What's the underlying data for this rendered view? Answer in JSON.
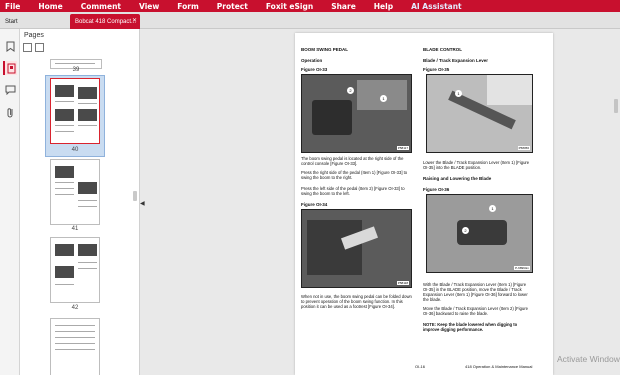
{
  "menubar": {
    "items": [
      "File",
      "Home",
      "Comment",
      "View",
      "Form",
      "Protect",
      "Foxit eSign",
      "Share",
      "Help",
      "AI Assistant"
    ],
    "color": "#c8102e"
  },
  "tabs": {
    "start": "Start",
    "document": "Bobcat 418 Compact..."
  },
  "sidebar": {
    "title": "Pages",
    "thumbnails": [
      "39",
      "40",
      "41",
      "42"
    ]
  },
  "page": {
    "left": {
      "heading": "BOOM SWING PEDAL",
      "subheading": "Operation",
      "fig1_label": "Figure OI-33",
      "fig1_tag": "P58117",
      "para1": "The boom swing pedal is located at the right side of the control console [Figure OI-33].",
      "para2": "Press the right side of the pedal (Item 1) [Figure OI-33] to swing the boom to the right.",
      "para3": "Press the left side of the pedal (Item 2) [Figure OI-33] to swing the boom to the left.",
      "fig2_label": "Figure OI-34",
      "fig2_tag": "P58118",
      "para4": "When not in use, the boom swing pedal can be folded down to prevent operation of the boom swing function. In this position it can be used as a footrest [Figure OI-34]."
    },
    "right": {
      "heading": "BLADE CONTROL",
      "subheading": "Blade / Track Expansion Lever",
      "fig1_label": "Figure OI-35",
      "fig1_tag": "P58056",
      "para1": "Lower the Blade / Track Expansion Lever (Item 1) [Figure OI-35] into the BLADE position.",
      "subheading2": "Raising and Lowering the Blade",
      "fig2_label": "Figure OI-36",
      "fig2_tag": "P-68994m",
      "para2": "With the Blade / Track Expansion Lever (Item 1) [Figure OI-35] in the BLADE position, move the Blade / Track Expansion Lever (Item 1) [Figure OI-36] forward to lower the blade.",
      "para3": "Move the Blade / Track Expansion Lever (Item 2) [Figure OI-36] backward to raise the blade.",
      "note": "NOTE: Keep the blade lowered when digging to improve digging performance."
    },
    "footer_left": "OI-16",
    "footer_right": "418 Operation & Maintenance Manual"
  },
  "watermark": "Activate Windows"
}
